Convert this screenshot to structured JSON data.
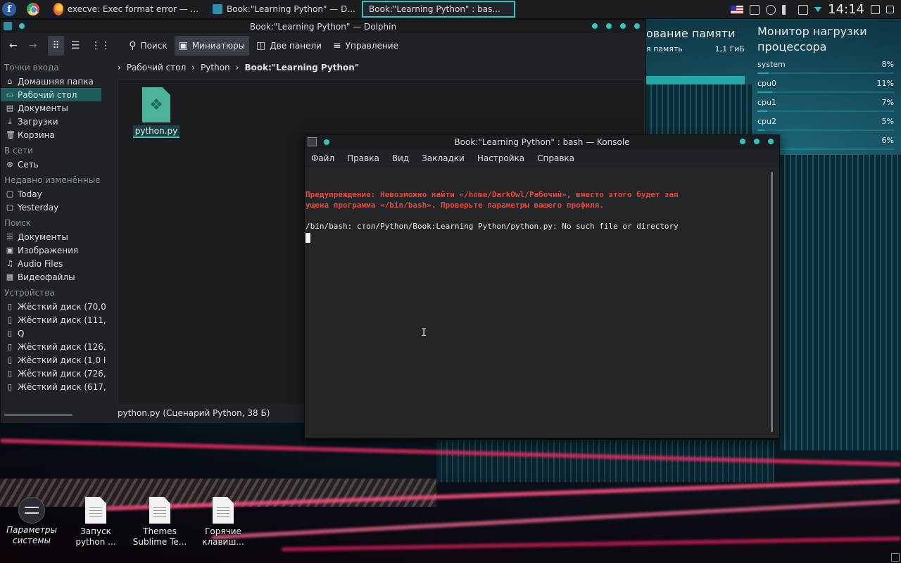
{
  "taskbar": {
    "tasks": [
      {
        "label": "execve: Exec format error — ..."
      },
      {
        "label": "Book:\"Learning Python\" — D..."
      },
      {
        "label": "Book:\"Learning Python\" : bas..."
      }
    ],
    "clock": "14:14"
  },
  "dolphin": {
    "title": "Book:\"Learning Python\" — Dolphin",
    "toolbar": {
      "search": "Поиск",
      "thumbnails": "Миниатюры",
      "split": "Две панели",
      "control": "Управление"
    },
    "sidebar": {
      "places_header": "Точки входа",
      "places": [
        "Домашняя папка",
        "Рабочий стол",
        "Документы",
        "Загрузки",
        "Корзина"
      ],
      "network_header": "В сети",
      "network": [
        "Сеть"
      ],
      "recent_header": "Недавно изменённые",
      "recent": [
        "Today",
        "Yesterday"
      ],
      "search_header": "Поиск",
      "search": [
        "Документы",
        "Изображения",
        "Audio Files",
        "Видеофайлы"
      ],
      "devices_header": "Устройства",
      "devices": [
        "Жёсткий диск (70,0",
        "Жёсткий диск (111,",
        "Q",
        "Жёсткий диск (126,",
        "Жёсткий диск (1,0 I",
        "Жёсткий диск (726,",
        "Жёсткий диск (617,"
      ]
    },
    "breadcrumb": [
      "Рабочий стол",
      "Python",
      "Book:\"Learning Python\""
    ],
    "file": {
      "name": "python.py"
    },
    "status": "python.py (Сценарий Python, 38 Б)"
  },
  "konsole": {
    "title": "Book:\"Learning Python\" : bash — Konsole",
    "menu": [
      "Файл",
      "Правка",
      "Вид",
      "Закладки",
      "Настройка",
      "Справка"
    ],
    "warning_line1": "Предупреждение: Невозможно найти «/home/DarkOwl/Рабочий», вместо этого будет зап",
    "warning_line2": "ущена программа «/bin/bash». Проверьте параметры вашего профиля.",
    "error_line": "/bin/bash: стол/Python/Book:Learning Python/python.py: No such file or directory"
  },
  "memory_widget": {
    "title": "ование памяти",
    "label": "я память",
    "value": "1,1 ГиБ"
  },
  "cpu_widget": {
    "title_line1": "Монитор нагрузки",
    "title_line2": "процессора",
    "rows": [
      {
        "name": "system",
        "value": "8%",
        "pct": 8
      },
      {
        "name": "cpu0",
        "value": "11%",
        "pct": 11
      },
      {
        "name": "cpu1",
        "value": "7%",
        "pct": 7
      },
      {
        "name": "cpu2",
        "value": "5%",
        "pct": 5
      },
      {
        "name": "",
        "value": "6%",
        "pct": 6
      }
    ]
  },
  "desktop": {
    "icons": [
      {
        "line1": "Параметры",
        "line2": "системы"
      },
      {
        "line1": "Запуск",
        "line2": "python ..."
      },
      {
        "line1": "Themes",
        "line2": "Sublime Te..."
      },
      {
        "line1": "Горячие",
        "line2": "клавиш..."
      }
    ]
  },
  "colors": {
    "accent": "#2ec5c5",
    "warning": "#e8483b",
    "selection": "#1b5e5e"
  }
}
